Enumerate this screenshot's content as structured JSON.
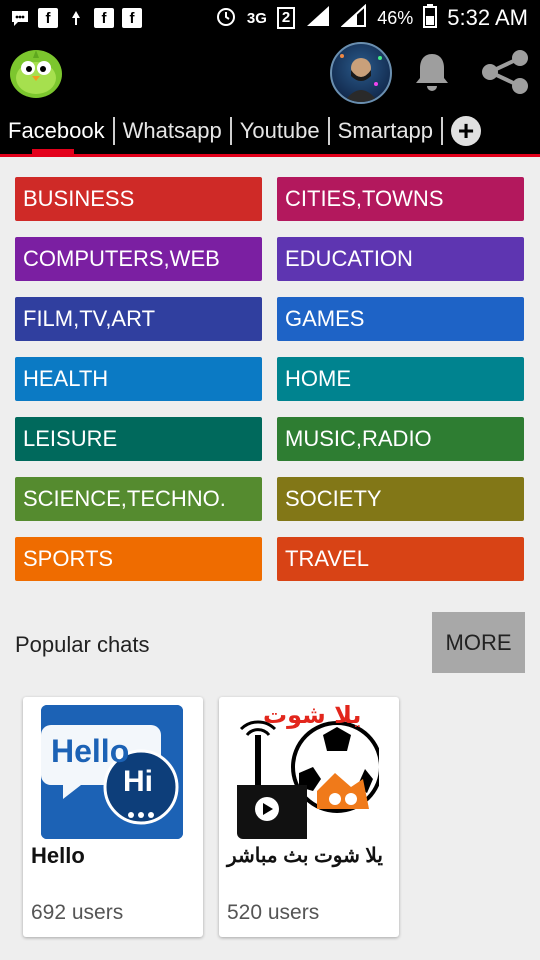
{
  "status_bar": {
    "network": "3G",
    "sim": "2",
    "battery": "46%",
    "time": "5:32 AM"
  },
  "app_bar": {
    "icons": [
      "app-logo-bird",
      "profile-avatar",
      "notification-bell",
      "share"
    ]
  },
  "tabs": [
    {
      "label": "Facebook"
    },
    {
      "label": "Whatsapp"
    },
    {
      "label": "Youtube"
    },
    {
      "label": "Smartapp"
    }
  ],
  "categories": [
    {
      "label": "BUSINESS",
      "color": "#cf2a27"
    },
    {
      "label": "CITIES,TOWNS",
      "color": "#b3185d"
    },
    {
      "label": "COMPUTERS,WEB",
      "color": "#7b1fa2"
    },
    {
      "label": "EDUCATION",
      "color": "#5e35b1"
    },
    {
      "label": "FILM,TV,ART",
      "color": "#303f9f"
    },
    {
      "label": "GAMES",
      "color": "#1e63c6"
    },
    {
      "label": "HEALTH",
      "color": "#0b7ac4"
    },
    {
      "label": "HOME",
      "color": "#00838f"
    },
    {
      "label": "LEISURE",
      "color": "#00695c"
    },
    {
      "label": "MUSIC,RADIO",
      "color": "#2e7d32"
    },
    {
      "label": "SCIENCE,TECHNO.",
      "color": "#558b2f"
    },
    {
      "label": "SOCIETY",
      "color": "#827717"
    },
    {
      "label": "SPORTS",
      "color": "#ef6c00"
    },
    {
      "label": "TRAVEL",
      "color": "#d84315"
    }
  ],
  "popular": {
    "heading": "Popular chats",
    "more_label": "MORE",
    "chats": [
      {
        "name": "Hello",
        "users": "692 users",
        "badge_big": "Hello",
        "badge_small": "Hi"
      },
      {
        "name": "يلا شوت بث مباشر",
        "users": "520 users",
        "banner": "يلا شوت"
      }
    ]
  }
}
